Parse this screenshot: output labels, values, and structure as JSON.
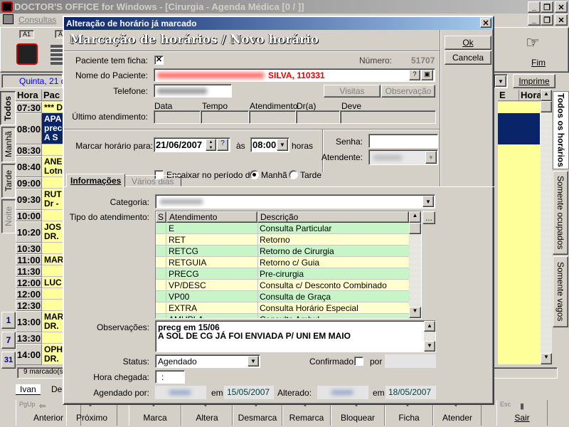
{
  "app": {
    "title": "DOCTOR'S OFFICE for Windows - [Cirurgia - Agenda Médica [0 / ]]",
    "menu": [
      "Consultas"
    ],
    "toolbar_tags": [
      "A1",
      "A"
    ],
    "fim_label": "Fim",
    "imprime_label": "Imprime",
    "date_label": "Quinta, 21 d"
  },
  "grid": {
    "headers": [
      "Hora",
      "Pac",
      "E",
      "Hora"
    ],
    "rows": [
      {
        "time": "07:30",
        "text": [
          "*** D"
        ]
      },
      {
        "time": "08:00",
        "text": [
          "APA",
          "prec",
          "A S"
        ],
        "selected": true
      },
      {
        "time": "08:30",
        "text": []
      },
      {
        "time": "08:40",
        "text": [
          "ANE",
          "Lotn"
        ]
      },
      {
        "time": "09:00",
        "text": []
      },
      {
        "time": "09:30",
        "text": [
          "RUT",
          "Dr -"
        ]
      },
      {
        "time": "10:00",
        "text": []
      },
      {
        "time": "10:20",
        "text": [
          "JOS",
          "DR."
        ]
      },
      {
        "time": "10:30",
        "text": []
      },
      {
        "time": "11:00",
        "text": [
          "MAR"
        ]
      },
      {
        "time": "11:30",
        "text": []
      },
      {
        "time": "12:00",
        "text": [
          "LUC"
        ]
      },
      {
        "time": "12:00",
        "text": []
      },
      {
        "time": "12:30",
        "text": []
      },
      {
        "time": "13:00",
        "text": [
          "MAR",
          "DR."
        ]
      },
      {
        "time": "13:30",
        "text": []
      },
      {
        "time": "14:00",
        "text": [
          "OPH",
          "DR."
        ]
      }
    ],
    "status": "9 marcado(s)",
    "left_tabs": [
      "Todos",
      "Manhã",
      "Tarde",
      "Noite"
    ],
    "right_tabs": [
      "Todos os horários",
      "Somente ocupados",
      "Somente vagos"
    ],
    "cal_icons": [
      "1",
      "7",
      "31"
    ],
    "doctor_tabs": [
      "Ivan",
      "De"
    ]
  },
  "bottom_toolbar": [
    {
      "key": "PgUp",
      "label": "Anterior"
    },
    {
      "label": "Próximo"
    },
    {
      "label": "Marca"
    },
    {
      "label": "Altera"
    },
    {
      "label": "Desmarca"
    },
    {
      "label": "Remarca"
    },
    {
      "label": "Bloquear"
    },
    {
      "label": "Ficha"
    },
    {
      "label": "Atender"
    },
    {
      "key": "Esc",
      "label": "Sair"
    }
  ],
  "dialog": {
    "title": "Alteração de horário já marcado",
    "heading": "Marcação de horários / Novo horário",
    "ok": "Ok",
    "cancel": "Cancela",
    "ficha_label": "Paciente tem ficha:",
    "ficha_checked": true,
    "numero_label": "Número:",
    "numero": "51707",
    "nome_label": "Nome do Paciente:",
    "nome_visible": "SILVA, 110331",
    "telefone_label": "Telefone:",
    "visitas": "Visitas",
    "observacao": "Observação",
    "ultimo_label": "Último atendimento:",
    "ultimo_cols": [
      "Data",
      "Tempo",
      "Atendimento",
      "Dr(a)",
      "Deve"
    ],
    "marcar_label": "Marcar horário para:",
    "date": "21/06/2007",
    "as": "às",
    "time": "08:00",
    "horas": "horas",
    "encaixar_label": "Encaixar no período da",
    "encaixar_checked": false,
    "periodo": [
      "Manhã",
      "Tarde"
    ],
    "periodo_selected": "Manhã",
    "senha_label": "Senha:",
    "atendente_label": "Atendente:",
    "tabs": [
      "Informações",
      "Vários dias"
    ],
    "active_tab": "Informações",
    "categoria_label": "Categoria:",
    "tipo_label": "Tipo do atendimento:",
    "table_headers": [
      "S",
      "Atendimento",
      "Descrição"
    ],
    "table_rows": [
      {
        "code": "E",
        "desc": "Consulta Particular"
      },
      {
        "code": "RET",
        "desc": "Retorno"
      },
      {
        "code": "RETCG",
        "desc": "Retorno de Cirurgia"
      },
      {
        "code": "RETGUIA",
        "desc": "Retorno c/ Guia"
      },
      {
        "code": "PRECG",
        "desc": "Pre-cirurgia"
      },
      {
        "code": "VP/DESC",
        "desc": "Consulta c/ Desconto Combinado"
      },
      {
        "code": "VP00",
        "desc": "Consulta de Graça"
      },
      {
        "code": "EXTRA",
        "desc": "Consulta Horário Especial"
      },
      {
        "code": "AMUPLA",
        "desc": "Consulta Ambul"
      }
    ],
    "more_button": "...",
    "obs_label": "Observações:",
    "obs_lines": [
      "precg em 15/06",
      "A SOL DE CG JÁ FOI ENVIADA P/ UNI EM MAIO"
    ],
    "status_label": "Status:",
    "status": "Agendado",
    "confirmado_label": "Confirmado:",
    "por_label": "por",
    "hora_chegada_label": "Hora chegada:",
    "hora_chegada": " :",
    "agendado_label": "Agendado por:",
    "em": "em",
    "agendado_date": "15/05/2007",
    "alterado_label": "Alterado:",
    "alterado_date": "18/05/2007"
  },
  "colors": {
    "title_blue": "#0a246a",
    "row_green": "#c8f5c8",
    "row_yellow": "#ffffd0",
    "grid_yellow": "#ffff99",
    "selected": "#0a246a",
    "date_text": "#004040"
  }
}
